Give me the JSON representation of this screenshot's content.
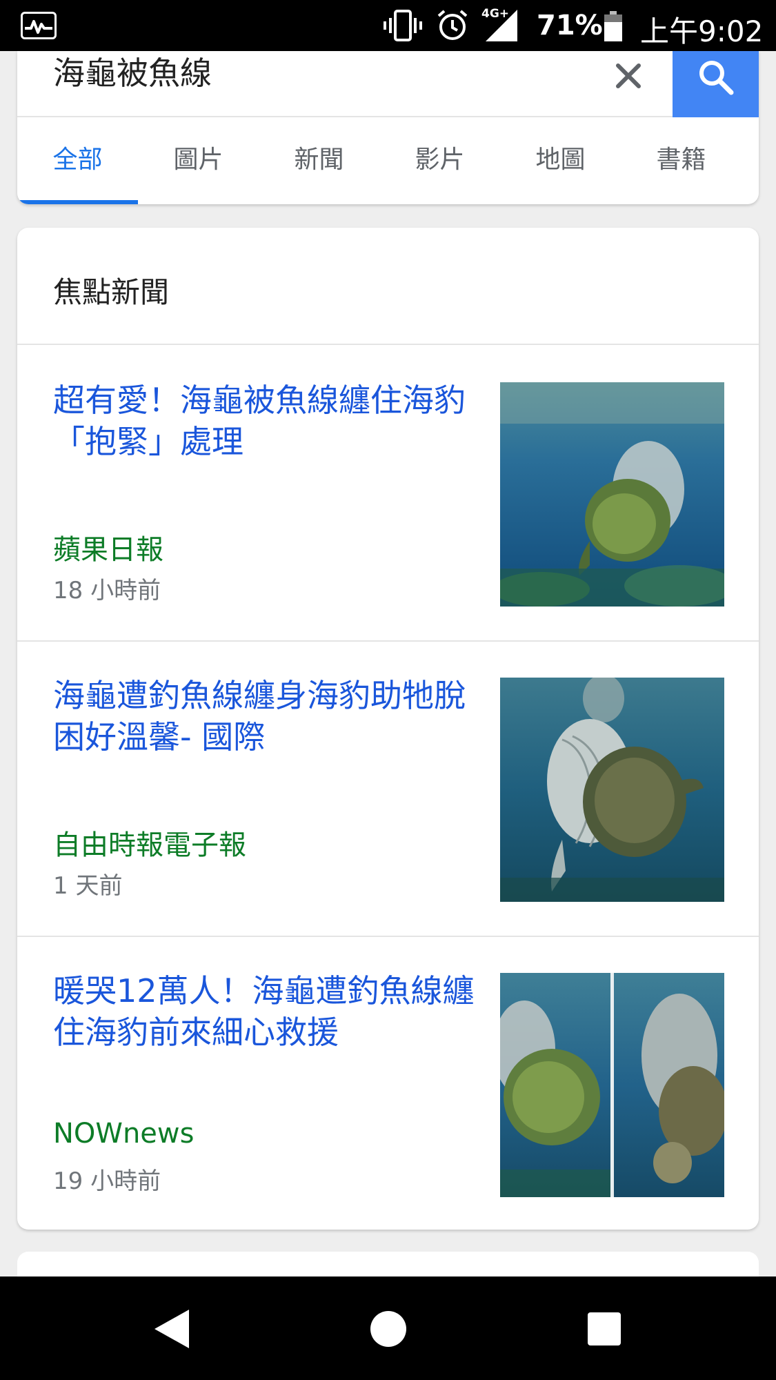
{
  "status_bar": {
    "network": "4G+",
    "battery_percent": "71%",
    "battery_level": 0.71,
    "time": "上午9:02",
    "icons": [
      "activity-icon",
      "vibrate-icon",
      "alarm-icon",
      "signal-icon",
      "battery-icon"
    ]
  },
  "search": {
    "query": "海龜被魚線",
    "clear_icon": "close-icon",
    "search_icon": "search-icon",
    "accent_color": "#4285f4"
  },
  "tabs": [
    {
      "label": "全部",
      "active": true
    },
    {
      "label": "圖片",
      "active": false
    },
    {
      "label": "新聞",
      "active": false
    },
    {
      "label": "影片",
      "active": false
    },
    {
      "label": "地圖",
      "active": false
    },
    {
      "label": "書籍",
      "active": false
    }
  ],
  "news": {
    "header": "焦點新聞",
    "articles": [
      {
        "title": "超有愛！海龜被魚線纏住海豹「抱緊」處理",
        "source": "蘋果日報",
        "time": "18 小時前"
      },
      {
        "title": "海龜遭釣魚線纏身海豹助牠脫困好溫馨- 國際",
        "source": "自由時報電子報",
        "time": "1 天前"
      },
      {
        "title": "暖哭12萬人！海龜遭釣魚線纏住海豹前來細心救援",
        "source": "NOWnews",
        "time": "19 小時前"
      }
    ]
  },
  "colors": {
    "link_blue": "#1a56db",
    "source_green": "#0d7c27",
    "tab_active": "#1a73e8"
  },
  "nav_bar": {
    "icons": [
      "back-icon",
      "home-icon",
      "recents-icon"
    ]
  }
}
